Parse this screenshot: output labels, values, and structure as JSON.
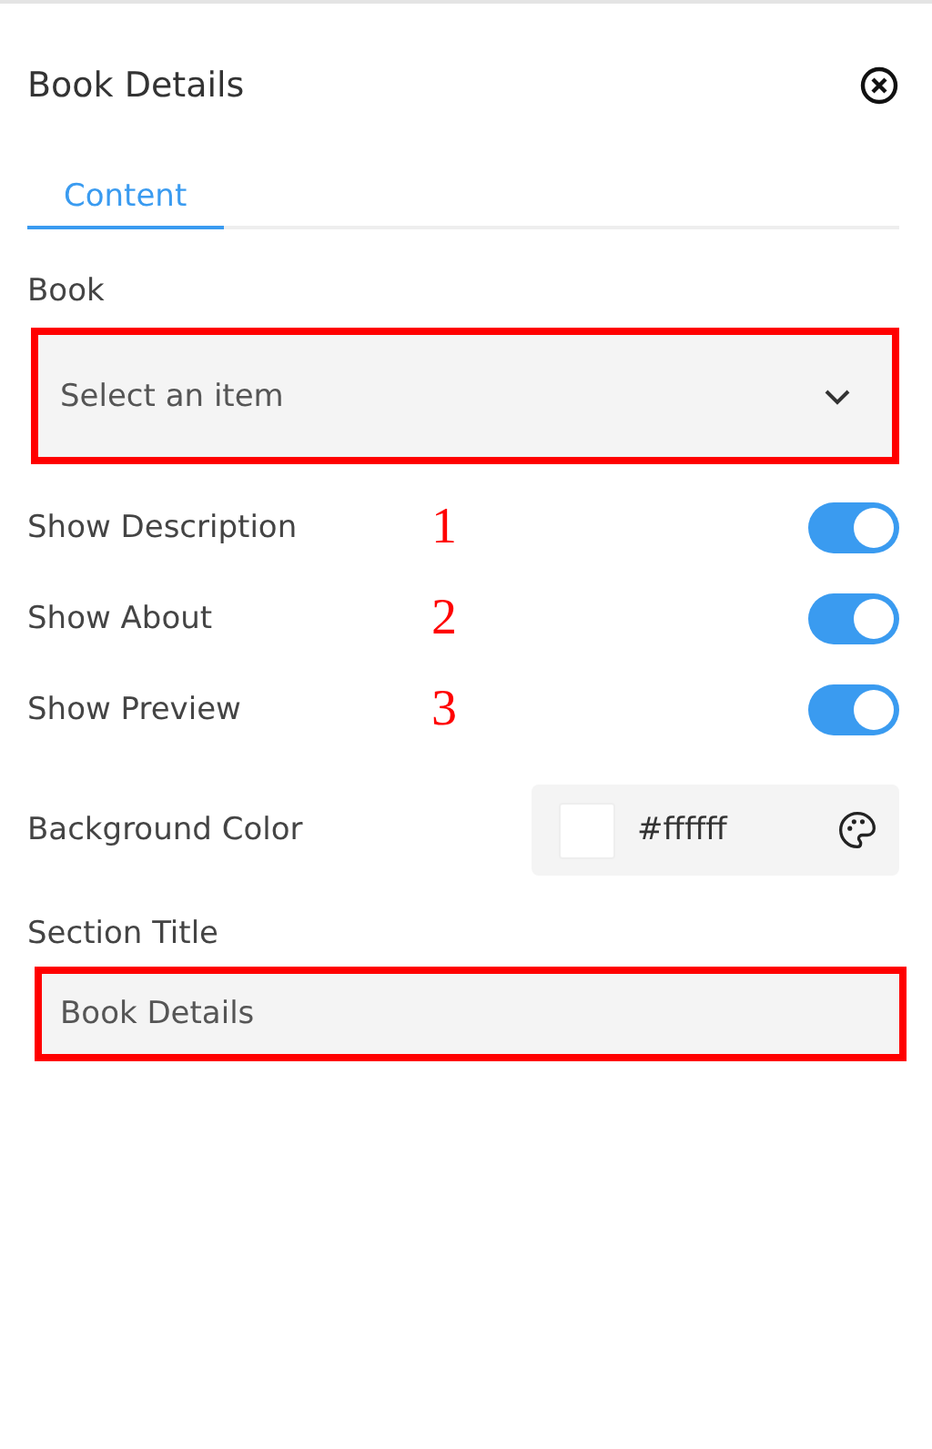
{
  "panel": {
    "title": "Book Details"
  },
  "tabs": [
    {
      "label": "Content",
      "selected": true
    }
  ],
  "book": {
    "label": "Book",
    "placeholder": "Select an item",
    "highlighted": true
  },
  "toggles": [
    {
      "label": "Show Description",
      "on": true,
      "annotation": "1"
    },
    {
      "label": "Show About",
      "on": true,
      "annotation": "2"
    },
    {
      "label": "Show Preview",
      "on": true,
      "annotation": "3"
    }
  ],
  "background_color": {
    "label": "Background Color",
    "value": "#ffffff",
    "color": "#ffffff"
  },
  "section_title": {
    "label": "Section Title",
    "value": "Book Details",
    "highlighted": true
  }
}
